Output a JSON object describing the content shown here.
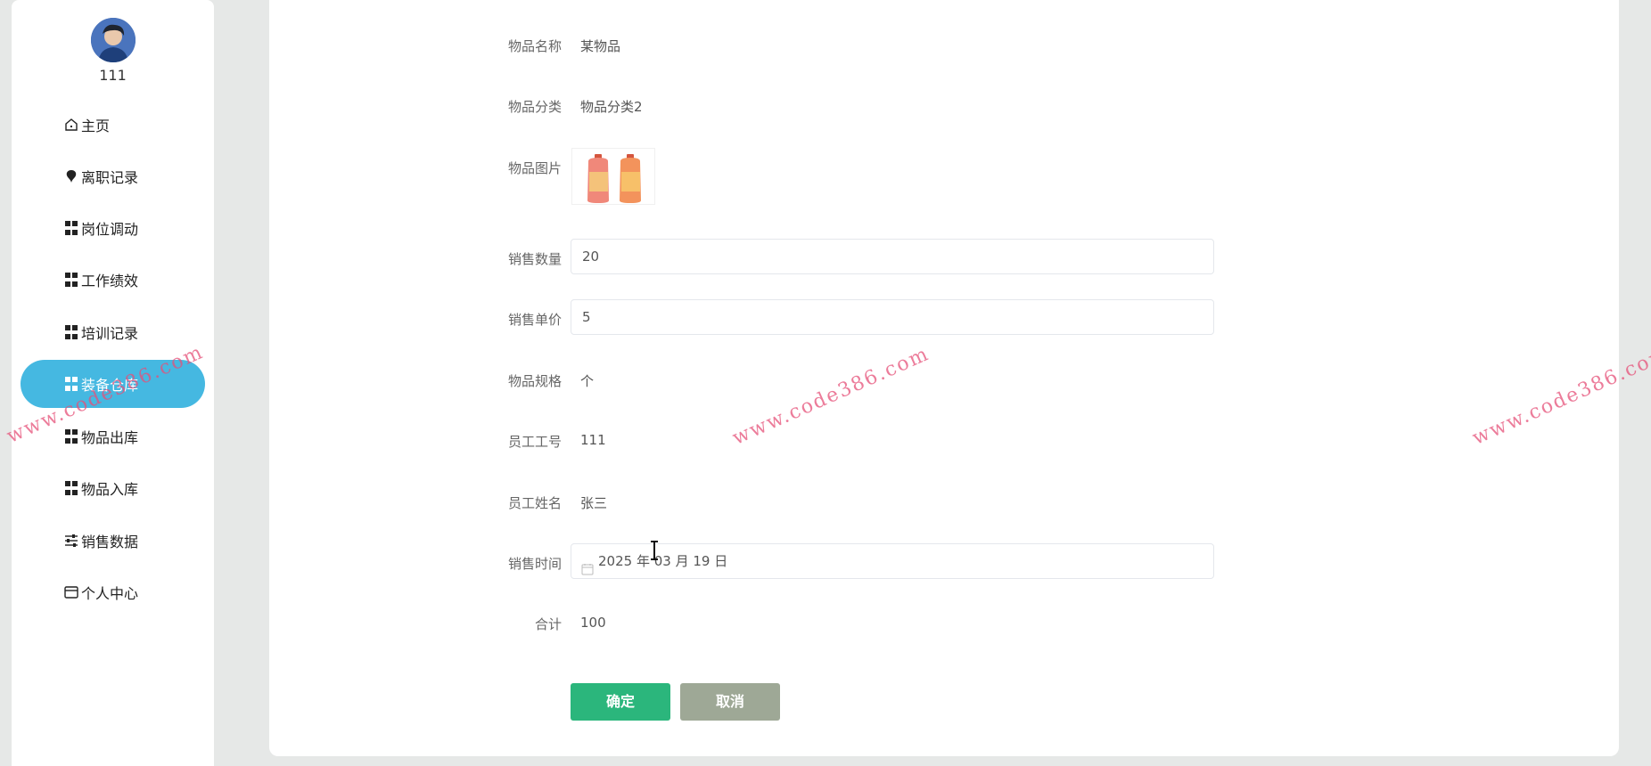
{
  "user": {
    "name": "111"
  },
  "nav": [
    {
      "label": "主页",
      "icon": "home-icon"
    },
    {
      "label": "离职记录",
      "icon": "pin-icon"
    },
    {
      "label": "岗位调动",
      "icon": "grid-icon"
    },
    {
      "label": "工作绩效",
      "icon": "grid-icon"
    },
    {
      "label": "培训记录",
      "icon": "grid-icon"
    },
    {
      "label": "装备仓库",
      "icon": "grid-icon",
      "active": true
    },
    {
      "label": "物品出库",
      "icon": "grid-icon"
    },
    {
      "label": "物品入库",
      "icon": "grid-icon"
    },
    {
      "label": "销售数据",
      "icon": "sliders-icon"
    },
    {
      "label": "个人中心",
      "icon": "card-icon"
    }
  ],
  "form": {
    "item_name": {
      "label": "物品名称",
      "value": "某物品"
    },
    "item_category": {
      "label": "物品分类",
      "value": "物品分类2"
    },
    "item_image": {
      "label": "物品图片"
    },
    "sales_quantity": {
      "label": "销售数量",
      "value": "20"
    },
    "sales_price": {
      "label": "销售单价",
      "value": "5"
    },
    "item_spec": {
      "label": "物品规格",
      "value": "个"
    },
    "employee_id": {
      "label": "员工工号",
      "value": "111"
    },
    "employee_name": {
      "label": "员工姓名",
      "value": "张三"
    },
    "sales_time": {
      "label": "销售时间",
      "value": "2025 年 03 月 19 日"
    },
    "total": {
      "label": "合计",
      "value": "100"
    }
  },
  "buttons": {
    "confirm": "确定",
    "cancel": "取消"
  },
  "watermark": "www.code386.com",
  "colors": {
    "active_nav": "#45b8e1",
    "confirm_button": "#2bb67c",
    "cancel_button": "#9ea896",
    "watermark": "#e65078"
  }
}
